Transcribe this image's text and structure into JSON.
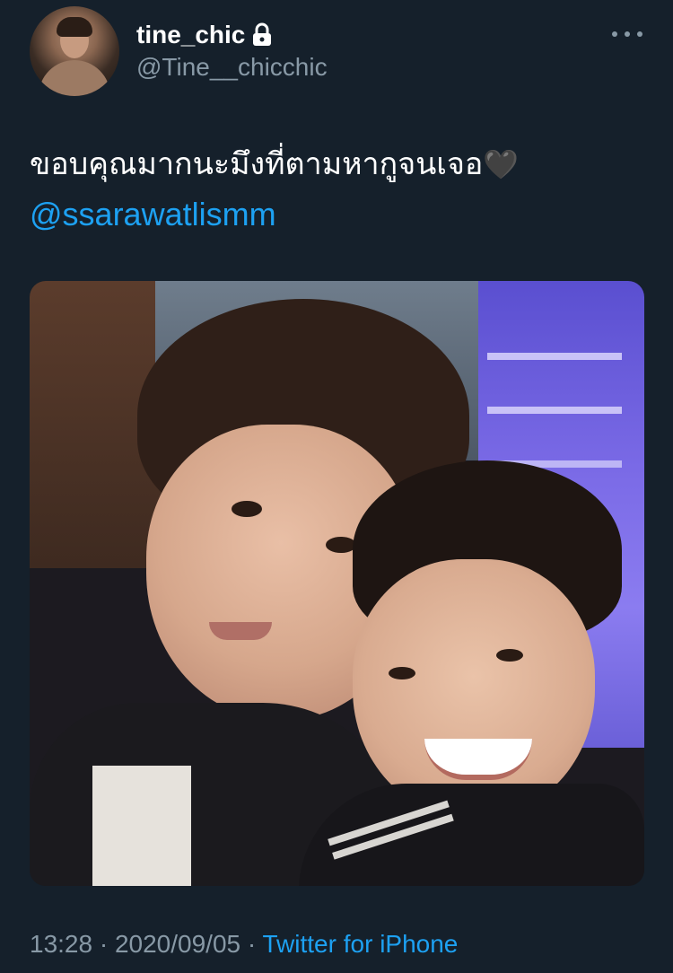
{
  "user": {
    "display_name": "tine_chic",
    "handle": "@Tine__chicchic",
    "protected_icon": "lock-icon",
    "avatar_icon": "avatar"
  },
  "header": {
    "more_icon": "more-icon"
  },
  "tweet": {
    "text": "ขอบคุณมากนะมึงที่ตามหากูจนเจอ",
    "emoji": "🖤",
    "mention": "@ssarawatlismm"
  },
  "media": {
    "type": "photo"
  },
  "meta": {
    "time": "13:28",
    "separator1": " · ",
    "date": "2020/09/05",
    "separator2": " · ",
    "source": "Twitter for iPhone"
  },
  "colors": {
    "background": "#15202b",
    "link": "#1da1f2",
    "secondary": "#8899a6"
  }
}
